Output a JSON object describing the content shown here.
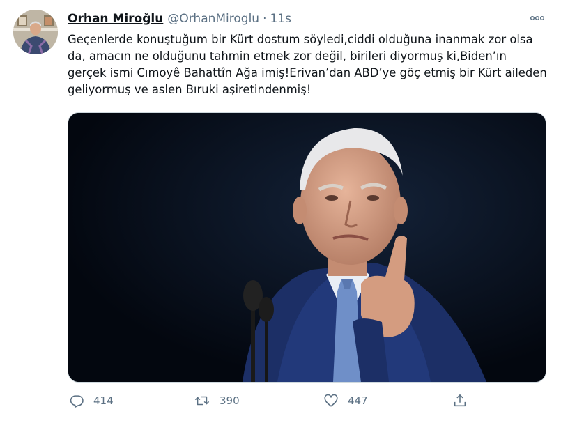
{
  "author": {
    "name": "Orhan Miroğlu",
    "handle": "@OrhanMiroglu",
    "separator": "·",
    "time": "11s",
    "avatar_icon": "profile-photo"
  },
  "tweet": {
    "text": "Geçenlerde konuştuğum bir Kürt dostum söyledi,ciddi olduğuna inanmak zor olsa da, amacın ne olduğunu tahmin etmek zor değil, birileri diyormuş ki,Biden’ın gerçek ismi Cımoyê Bahattîn Ağa imiş!Erivan’dan ABD’ye göç etmiş bir Kürt aileden geliyormuş ve aslen Bıruki aşiretindenmiş!"
  },
  "actions": {
    "reply_count": "414",
    "retweet_count": "390",
    "like_count": "447"
  },
  "icons": {
    "more": "more-icon",
    "reply": "reply-icon",
    "retweet": "retweet-icon",
    "like": "heart-icon",
    "share": "share-icon"
  },
  "colors": {
    "text": "#0f1419",
    "secondary": "#5b7083",
    "border": "#cfd9de",
    "photo_background": "#050a16",
    "suit": "#1c2f66",
    "tie": "#6f8fc8"
  }
}
